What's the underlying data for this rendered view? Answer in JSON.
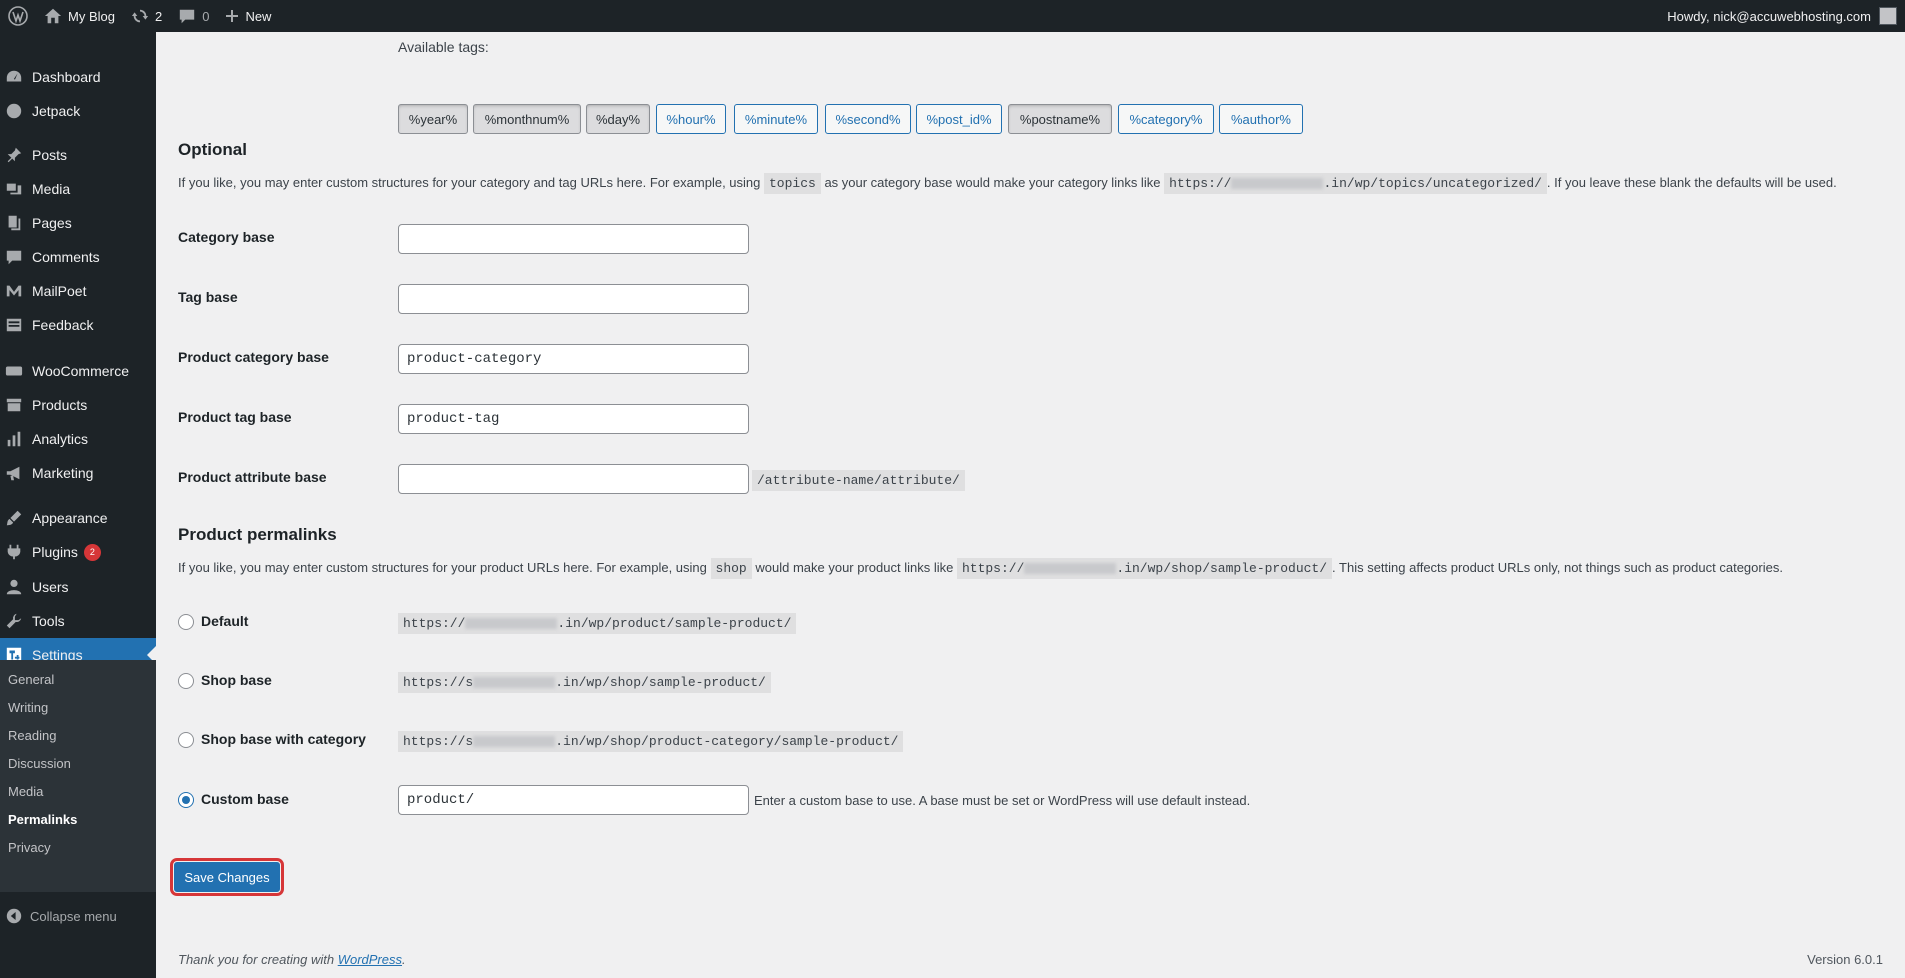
{
  "adminbar": {
    "site_name": "My Blog",
    "updates_count": "2",
    "comments_count": "0",
    "new_label": "New",
    "howdy": "Howdy, nick@accuwebhosting.com"
  },
  "sidebar": {
    "items": [
      {
        "label": "Dashboard",
        "icon": "dashboard-icon"
      },
      {
        "label": "Jetpack",
        "icon": "jetpack-icon"
      },
      {
        "label": "Posts",
        "icon": "pin-icon"
      },
      {
        "label": "Media",
        "icon": "media-icon"
      },
      {
        "label": "Pages",
        "icon": "page-icon"
      },
      {
        "label": "Comments",
        "icon": "comment-icon"
      },
      {
        "label": "MailPoet",
        "icon": "mailpoet-icon"
      },
      {
        "label": "Feedback",
        "icon": "feedback-icon"
      },
      {
        "label": "WooCommerce",
        "icon": "woo-icon"
      },
      {
        "label": "Products",
        "icon": "archive-icon"
      },
      {
        "label": "Analytics",
        "icon": "chart-icon"
      },
      {
        "label": "Marketing",
        "icon": "megaphone-icon"
      },
      {
        "label": "Appearance",
        "icon": "brush-icon"
      },
      {
        "label": "Plugins",
        "icon": "plug-icon",
        "badge": "2"
      },
      {
        "label": "Users",
        "icon": "user-icon"
      },
      {
        "label": "Tools",
        "icon": "wrench-icon"
      },
      {
        "label": "Settings",
        "icon": "settings-icon"
      }
    ],
    "submenu": [
      "General",
      "Writing",
      "Reading",
      "Discussion",
      "Media",
      "Permalinks",
      "Privacy"
    ],
    "collapse_label": "Collapse menu"
  },
  "available_tags": {
    "label": "Available tags:",
    "tags": [
      "%year%",
      "%monthnum%",
      "%day%",
      "%hour%",
      "%minute%",
      "%second%",
      "%post_id%",
      "%postname%",
      "%category%",
      "%author%"
    ]
  },
  "optional": {
    "heading": "Optional",
    "desc_1": "If you like, you may enter custom structures for your category and tag URLs here. For example, using",
    "desc_code1": "topics",
    "desc_2": "as your category base would make your category links like",
    "desc_code2a": "https://",
    "desc_code2b": ".in/wp/topics/uncategorized/",
    "desc_3": ". If you leave these blank the defaults will be used.",
    "fields": [
      {
        "label": "Category base",
        "value": ""
      },
      {
        "label": "Tag base",
        "value": ""
      },
      {
        "label": "Product category base",
        "value": "product-category"
      },
      {
        "label": "Product tag base",
        "value": "product-tag"
      },
      {
        "label": "Product attribute base",
        "value": "",
        "suffix": "/attribute-name/attribute/"
      }
    ]
  },
  "product_permalinks": {
    "heading": "Product permalinks",
    "desc_1": "If you like, you may enter custom structures for your product URLs here. For example, using",
    "desc_code1": "shop",
    "desc_2": "would make your product links like",
    "desc_code2a": "https://",
    "desc_code2b": ".in/wp/shop/sample-product/",
    "desc_3": ". This setting affects product URLs only, not things such as product categories.",
    "options": [
      {
        "label": "Default",
        "url_a": "https://",
        "url_b": ".in/wp/product/sample-product/",
        "checked": false
      },
      {
        "label": "Shop base",
        "url_a": "https://s",
        "url_b": ".in/wp/shop/sample-product/",
        "checked": false
      },
      {
        "label": "Shop base with category",
        "url_a": "https://s",
        "url_b": ".in/wp/shop/product-category/sample-product/",
        "checked": false
      },
      {
        "label": "Custom base",
        "value": "product/",
        "hint": "Enter a custom base to use. A base must be set or WordPress will use default instead.",
        "checked": true
      }
    ]
  },
  "save_label": "Save Changes",
  "footer": {
    "thanks_1": "Thank you for creating with",
    "wp_link": "WordPress",
    "thanks_2": ".",
    "version": "Version 6.0.1"
  },
  "colors": {
    "accent": "#2271b1",
    "adminbar_bg": "#1d2327",
    "highlight_border": "#d63638"
  }
}
